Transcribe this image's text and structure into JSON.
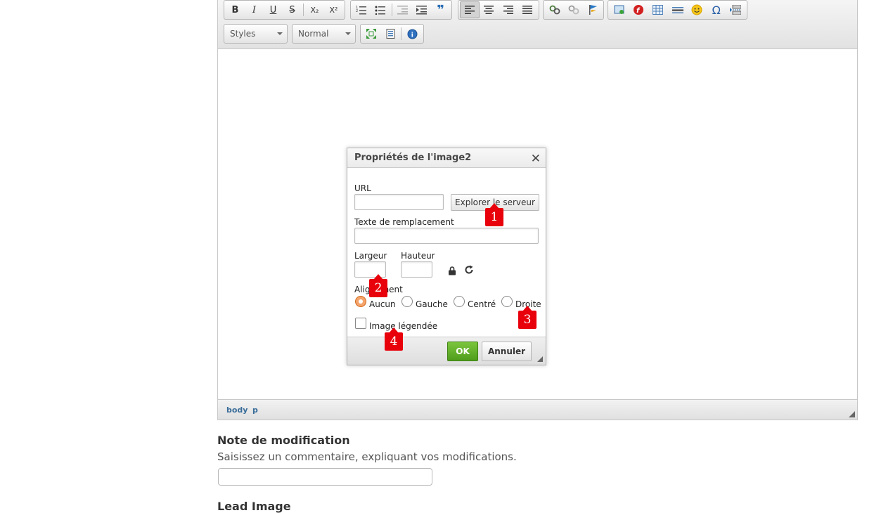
{
  "toolbar": {
    "styles_label": "Styles",
    "format_label": "Normal",
    "buttons": {
      "bold": "B",
      "italic": "I",
      "underline": "U",
      "strike": "S",
      "subscript": "X₂",
      "superscript": "X²",
      "blockquote": "❞",
      "special_char": "Ω"
    }
  },
  "statusbar": {
    "path": [
      "body",
      "p"
    ]
  },
  "dialog": {
    "title": "Propriétés de l'image2",
    "close": "✕",
    "url_label": "URL",
    "url_value": "",
    "browse_button": "Explorer le serveur",
    "alt_label": "Texte de remplacement",
    "alt_value": "",
    "width_label": "Largeur",
    "height_label": "Hauteur",
    "alignment_label": "Alignement",
    "alignment_options": [
      "Aucun",
      "Gauche",
      "Centré",
      "Droite"
    ],
    "alignment_selected": "Aucun",
    "caption_label": "Image légendée",
    "ok_button": "OK",
    "cancel_button": "Annuler"
  },
  "markers": [
    "1",
    "2",
    "3",
    "4"
  ],
  "form": {
    "note_title": "Note de modification",
    "note_help": "Saisissez un commentaire, expliquant vos modifications.",
    "note_value": "",
    "lead_image_title": "Lead Image"
  },
  "colors": {
    "ok_green": "#5fae28",
    "marker_red": "#e8000b",
    "path_blue": "#3a6d9a",
    "radio_selected": "#f4a46a"
  }
}
